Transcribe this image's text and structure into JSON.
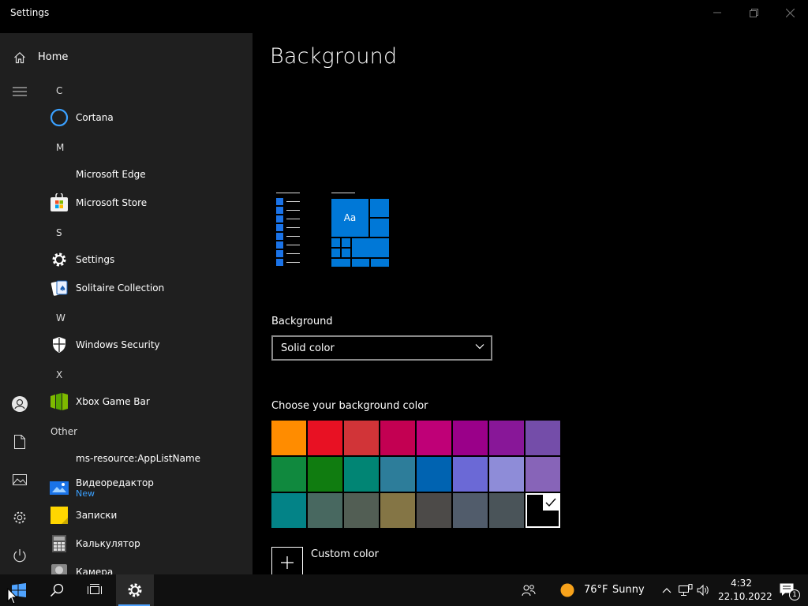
{
  "window": {
    "title": "Settings",
    "minimize_icon": "minimize-icon",
    "restore_icon": "restore-icon",
    "close_icon": "close-icon"
  },
  "page": {
    "title": "Background",
    "background_label": "Background",
    "background_value": "Solid color",
    "choose_label": "Choose your background color",
    "custom_color_label": "Custom color"
  },
  "colors": {
    "rows": [
      [
        "#ff8c00",
        "#e81123",
        "#d13438",
        "#c30052",
        "#bf0077",
        "#9a0089",
        "#881798",
        "#744da9"
      ],
      [
        "#10893e",
        "#107c10",
        "#018574",
        "#2d7d9a",
        "#0063b1",
        "#6b69d6",
        "#8e8cd8",
        "#8764b8"
      ],
      [
        "#038387",
        "#486860",
        "#525e54",
        "#847545",
        "#4c4a48",
        "#515c6b",
        "#4a5459",
        "#000000"
      ]
    ],
    "selected": "#000000",
    "accent": "#0078d7"
  },
  "start_menu": {
    "home_label": "Home",
    "groups": [
      {
        "letter": "C",
        "apps": [
          {
            "name": "Cortana",
            "icon": "cortana-icon"
          }
        ]
      },
      {
        "letter": "M",
        "apps": [
          {
            "name": "Microsoft Edge",
            "icon": ""
          },
          {
            "name": "Microsoft Store",
            "icon": "store-icon"
          }
        ]
      },
      {
        "letter": "S",
        "apps": [
          {
            "name": "Settings",
            "icon": "gear-icon"
          },
          {
            "name": "Solitaire Collection",
            "icon": "cards-icon"
          }
        ]
      },
      {
        "letter": "W",
        "apps": [
          {
            "name": "Windows Security",
            "icon": "shield-icon"
          }
        ]
      },
      {
        "letter": "X",
        "apps": [
          {
            "name": "Xbox Game Bar",
            "icon": "xbox-icon"
          }
        ]
      }
    ],
    "other_label": "Other",
    "other_apps": [
      {
        "name": "ms-resource:AppListName",
        "sub": ""
      },
      {
        "name": "Видеоредактор",
        "sub": "New"
      },
      {
        "name": "Записки",
        "sub": ""
      },
      {
        "name": "Калькулятор",
        "sub": ""
      },
      {
        "name": "Камера",
        "sub": ""
      }
    ]
  },
  "taskbar": {
    "weather_temp": "76°F",
    "weather_desc": "Sunny",
    "time": "4:32",
    "date": "22.10.2022",
    "notification_count": "1"
  }
}
